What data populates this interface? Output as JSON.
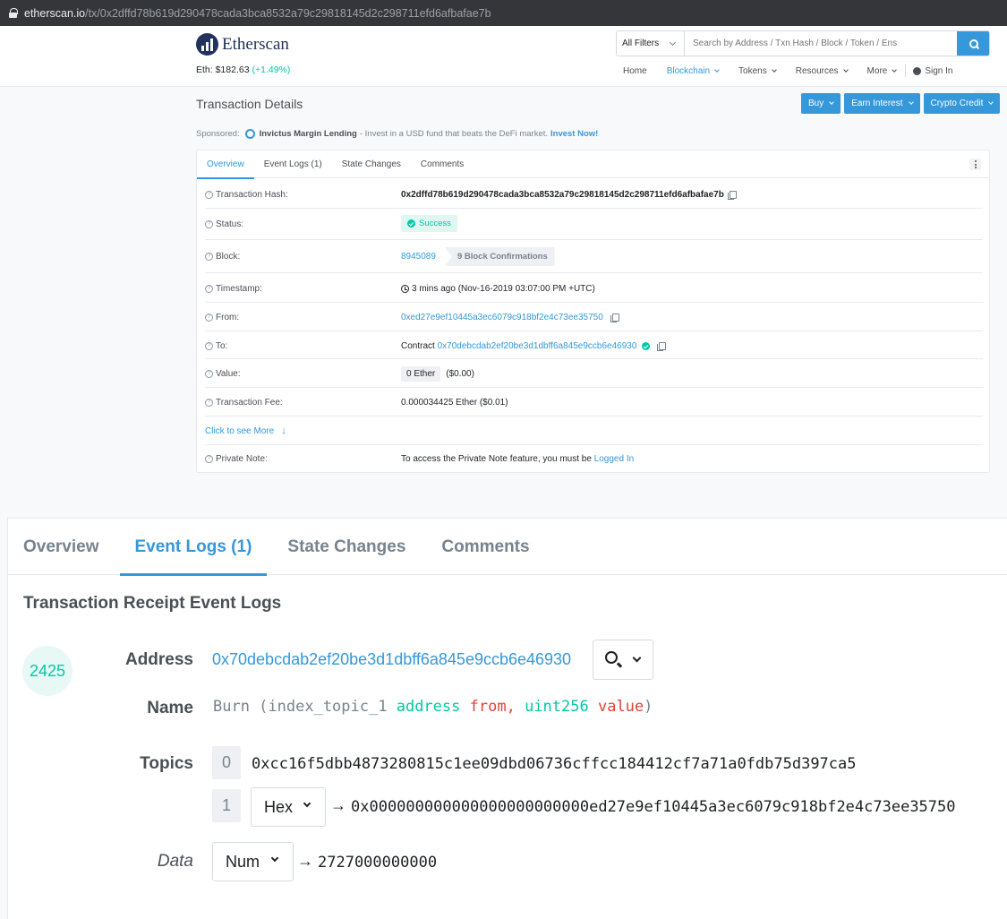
{
  "browser": {
    "url_host": "etherscan.io",
    "url_path": "/tx/0x2dffd78b619d290478cada3bca8532a79c29818145d2c298711efd6afbafae7b"
  },
  "header": {
    "logo_text": "Etherscan",
    "eth_price_label": "Eth: $182.63",
    "eth_change": "(+1.49%)",
    "filter_label": "All Filters",
    "search_placeholder": "Search by Address / Txn Hash / Block / Token / Ens",
    "nav": [
      "Home",
      "Blockchain",
      "Tokens",
      "Resources",
      "More"
    ],
    "sign_in": "Sign In"
  },
  "page": {
    "title": "Transaction Details",
    "buttons": [
      "Buy",
      "Earn Interest",
      "Crypto Credit"
    ],
    "sponsored_label": "Sponsored:",
    "sponsor_name": "Invictus Margin Lending",
    "sponsor_text": "- Invest in a USD fund that beats the DeFi market.",
    "sponsor_cta": "Invest Now!"
  },
  "card": {
    "tabs": [
      "Overview",
      "Event Logs (1)",
      "State Changes",
      "Comments"
    ],
    "tx_hash_label": "Transaction Hash:",
    "tx_hash": "0x2dffd78b619d290478cada3bca8532a79c29818145d2c298711efd6afbafae7b",
    "status_label": "Status:",
    "status": "Success",
    "block_label": "Block:",
    "block": "8945089",
    "confirmations": "9 Block Confirmations",
    "timestamp_label": "Timestamp:",
    "timestamp": "3 mins ago (Nov-16-2019 03:07:00 PM +UTC)",
    "from_label": "From:",
    "from": "0xed27e9ef10445a3ec6079c918bf2e4c73ee35750",
    "to_label": "To:",
    "to_prefix": "Contract",
    "to": "0x70debcdab2ef20be3d1dbff6a845e9ccb6e46930",
    "value_label": "Value:",
    "value": "0 Ether",
    "value_usd": "($0.00)",
    "fee_label": "Transaction Fee:",
    "fee": "0.000034425 Ether ($0.01)",
    "see_more": "Click to see More",
    "note_label": "Private Note:",
    "note_text": "To access the Private Note feature, you must be",
    "note_link": "Logged In"
  },
  "zoom": {
    "tabs": [
      "Overview",
      "Event Logs (1)",
      "State Changes",
      "Comments"
    ],
    "title": "Transaction Receipt Event Logs",
    "log_index": "2425",
    "address_label": "Address",
    "address": "0x70debcdab2ef20be3d1dbff6a845e9ccb6e46930",
    "name_label": "Name",
    "name_fn": "Burn (index_topic_1",
    "name_type1": "address",
    "name_arg1": "from,",
    "name_type2": "uint256",
    "name_arg2": "value",
    "name_close": ")",
    "topics_label": "Topics",
    "topic0_index": "0",
    "topic0": "0xcc16f5dbb4873280815c1ee09dbd06736cffcc184412cf7a71a0fdb75d397ca5",
    "topic1_index": "1",
    "topic1_format": "Hex",
    "topic1": "0x000000000000000000000000ed27e9ef10445a3ec6079c918bf2e4c73ee35750",
    "data_label": "Data",
    "data_format": "Num",
    "data_value": "2727000000000",
    "arrow": "→"
  },
  "colors": {
    "accent": "#3498db",
    "success": "#00c9a7",
    "brand": "#21325b"
  }
}
